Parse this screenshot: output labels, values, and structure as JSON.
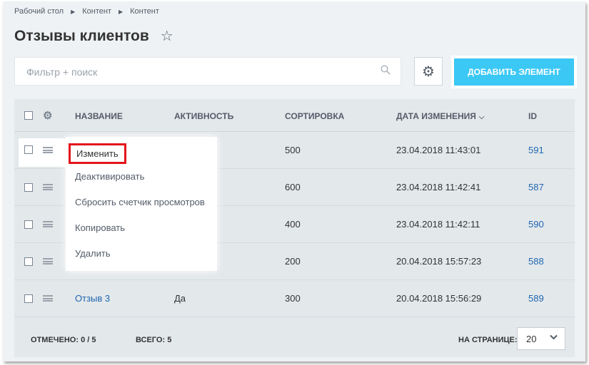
{
  "breadcrumb": [
    "Рабочий стол",
    "Контент",
    "Контент"
  ],
  "page": {
    "title": "Отзывы клиентов"
  },
  "filter": {
    "placeholder": "Фильтр + поиск"
  },
  "toolbar": {
    "add_label": "ДОБАВИТЬ ЭЛЕМЕНТ"
  },
  "table": {
    "columns": {
      "name": "НАЗВАНИЕ",
      "activity": "АКТИВНОСТЬ",
      "sort": "СОРТИРОВКА",
      "date": "ДАТА ИЗМЕНЕНИЯ",
      "id": "ID"
    },
    "rows": [
      {
        "name": "",
        "activity": "",
        "sort": "500",
        "date": "23.04.2018 11:43:01",
        "id": "591"
      },
      {
        "name": "",
        "activity": "",
        "sort": "600",
        "date": "23.04.2018 11:42:41",
        "id": "587"
      },
      {
        "name": "",
        "activity": "",
        "sort": "400",
        "date": "23.04.2018 11:42:11",
        "id": "590"
      },
      {
        "name": "",
        "activity": "",
        "sort": "200",
        "date": "20.04.2018 15:57:23",
        "id": "588"
      },
      {
        "name": "Отзыв 3",
        "activity": "Да",
        "sort": "300",
        "date": "20.04.2018 15:56:29",
        "id": "589"
      }
    ]
  },
  "footer": {
    "selected_label": "ОТМЕЧЕНО:",
    "selected_value": "0 / 5",
    "total_label": "ВСЕГО:",
    "total_value": "5",
    "per_page_label": "НА СТРАНИЦЕ:",
    "per_page_value": "20"
  },
  "context_menu": {
    "items": [
      "Изменить",
      "Деактивировать",
      "Сбросить счетчик просмотров",
      "Копировать",
      "Удалить"
    ]
  },
  "icons": {
    "star": "star-icon",
    "gear": "gear-icon",
    "search": "search-icon",
    "menu": "hamburger-icon",
    "chevron": "chevron-down-icon"
  },
  "colors": {
    "accent": "#3bc8f5",
    "highlight": "#e3141b",
    "link": "#2067b0"
  }
}
